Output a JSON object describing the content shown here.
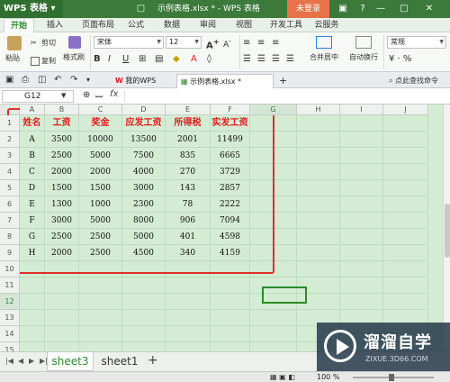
{
  "app": {
    "logo": "WPS 表格",
    "title": "示例表格.xlsx * - WPS 表格",
    "login": "未登录"
  },
  "menu": [
    "开始",
    "插入",
    "页面布局",
    "公式",
    "数据",
    "审阅",
    "视图",
    "开发工具",
    "云服务"
  ],
  "ribbon": {
    "paste": "粘贴",
    "cut": "剪切",
    "copy": "复制",
    "format_painter": "格式刷",
    "font": "宋体",
    "size": "12",
    "merge": "合并居中",
    "wrap": "自动换行",
    "number_format": "常规"
  },
  "doc_tabs": {
    "home": "我的WPS",
    "file": "示例表格.xlsx *",
    "tip": "点此查找命令"
  },
  "formula_bar": {
    "name_box": "G12",
    "fx": "fx",
    "value": ""
  },
  "grid": {
    "columns": [
      "A",
      "B",
      "C",
      "D",
      "E",
      "F",
      "G",
      "H",
      "I",
      "J"
    ],
    "rows": [
      "1",
      "2",
      "3",
      "4",
      "5",
      "6",
      "7",
      "8",
      "9",
      "10",
      "11",
      "12",
      "13",
      "14",
      "15"
    ],
    "selected_col": "G",
    "selected_row": "12",
    "headers": [
      "姓名",
      "工资",
      "奖金",
      "应发工资",
      "所得税",
      "实发工资"
    ],
    "data": [
      [
        "A",
        "3500",
        "10000",
        "13500",
        "2001",
        "11499"
      ],
      [
        "B",
        "2500",
        "5000",
        "7500",
        "835",
        "6665"
      ],
      [
        "C",
        "2000",
        "2000",
        "4000",
        "270",
        "3729"
      ],
      [
        "D",
        "1500",
        "1500",
        "3000",
        "143",
        "2857"
      ],
      [
        "E",
        "1300",
        "1000",
        "2300",
        "78",
        "2222"
      ],
      [
        "F",
        "3000",
        "5000",
        "8000",
        "906",
        "7094"
      ],
      [
        "G",
        "2500",
        "2500",
        "5000",
        "401",
        "4598"
      ],
      [
        "H",
        "2000",
        "2500",
        "4500",
        "340",
        "4159"
      ]
    ]
  },
  "sheets": [
    "sheet3",
    "sheet1"
  ],
  "status": {
    "zoom": "100 %"
  },
  "watermark": {
    "title": "溜溜自学",
    "url": "ZIXUE.3D66.COM"
  }
}
